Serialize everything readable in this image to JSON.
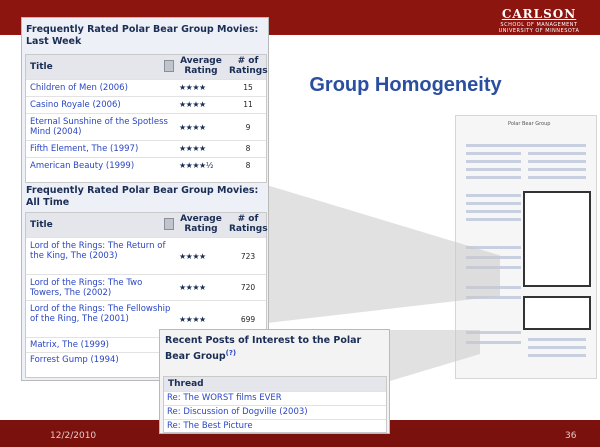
{
  "slide": {
    "date": "12/2/2010",
    "page_number": "36",
    "heading": "Group Homogeneity"
  },
  "logo": {
    "line1": "CARLSON",
    "line2": "SCHOOL OF MANAGEMENT",
    "line3": "UNIVERSITY OF MINNESOTA"
  },
  "last_week": {
    "title": "Frequently Rated Polar Bear Group Movies: Last Week",
    "headers": {
      "title": "Title",
      "avg": "Average Rating",
      "count": "# of Ratings"
    },
    "rows": [
      {
        "title": "Children of Men (2006)",
        "stars": "★★★★",
        "count": "15"
      },
      {
        "title": "Casino Royale (2006)",
        "stars": "★★★★",
        "count": "11"
      },
      {
        "title": "Eternal Sunshine of the Spotless Mind (2004)",
        "stars": "★★★★",
        "count": "9"
      },
      {
        "title": "Fifth Element, The (1997)",
        "stars": "★★★★",
        "count": "8"
      },
      {
        "title": "American Beauty (1999)",
        "stars": "★★★★½",
        "count": "8"
      }
    ]
  },
  "all_time": {
    "title": "Frequently Rated Polar Bear Group Movies: All Time",
    "headers": {
      "title": "Title",
      "avg": "Average Rating",
      "count": "# of Ratings"
    },
    "rows": [
      {
        "title": "Lord of the Rings: The Return of the King, The (2003)",
        "stars": "★★★★",
        "count": "723"
      },
      {
        "title": "Lord of the Rings: The Two Towers, The (2002)",
        "stars": "★★★★",
        "count": "720"
      },
      {
        "title": "Lord of the Rings: The Fellowship of the Ring, The (2001)",
        "stars": "★★★★",
        "count": "699"
      },
      {
        "title": "Matrix, The (1999)",
        "stars": "",
        "count": ""
      },
      {
        "title": "Forrest Gump (1994)",
        "stars": "",
        "count": ""
      }
    ]
  },
  "recent_posts": {
    "title": "Recent Posts of Interest to the Polar Bear Group",
    "help": "(?)",
    "header": "Thread",
    "rows": [
      "Re: The WORST films EVER",
      "Re: Discussion of Dogville (2003)",
      "Re: The Best Picture"
    ]
  },
  "thumbnail": {
    "title": "Polar Bear Group"
  }
}
